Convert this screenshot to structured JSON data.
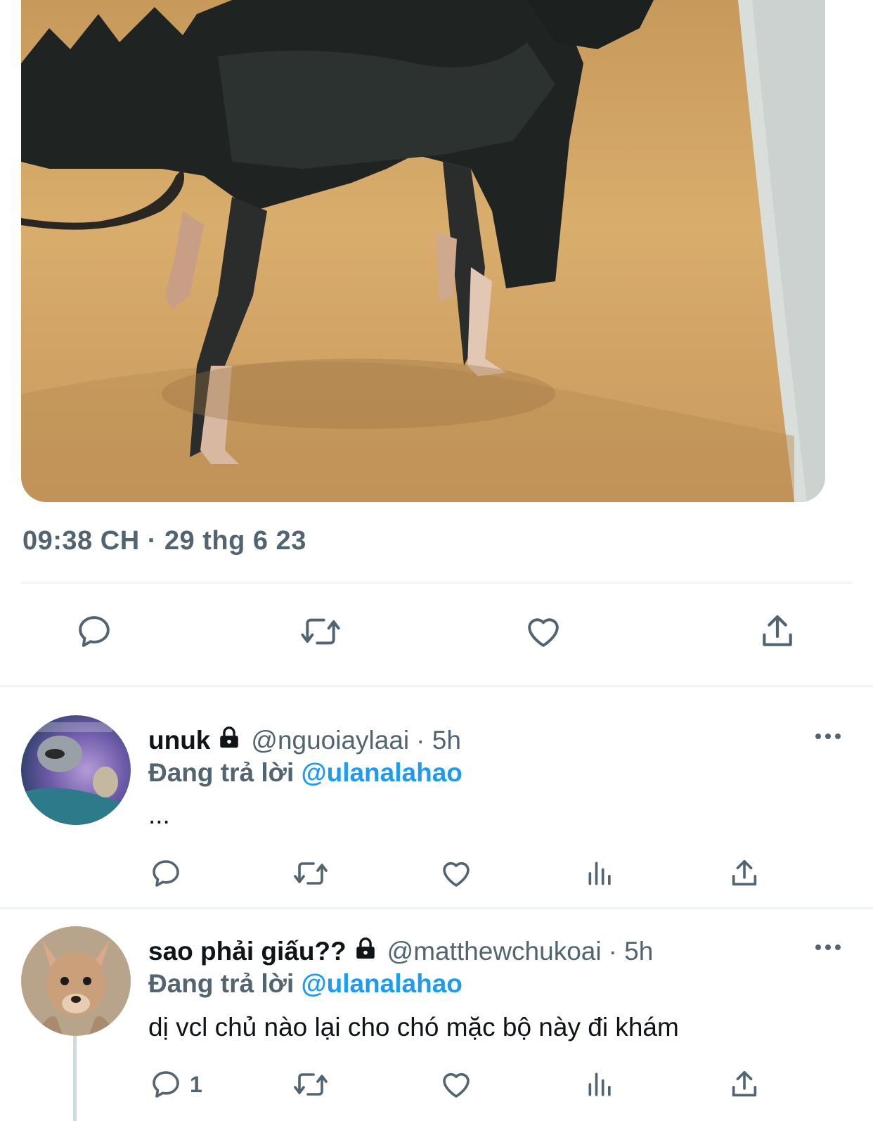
{
  "tweet": {
    "media_alt": "dog photo",
    "timestamp": "09:38 CH · 29 thg 6 23"
  },
  "tweet_actions": [
    "reply-icon",
    "retweet-icon",
    "like-icon",
    "share-icon"
  ],
  "replies": [
    {
      "display_name": "unuk",
      "handle": "@nguoiaylaai",
      "time": "· 5h",
      "replying_prefix": "Đang trả lời",
      "replying_to": "@ulanalahao",
      "text": "...",
      "reply_count": ""
    },
    {
      "display_name": "sao phải giấu??",
      "handle": "@matthewchukoai",
      "time": "· 5h",
      "replying_prefix": "Đang trả lời",
      "replying_to": "@ulanalahao",
      "text": "dị vcl chủ nào lại cho chó mặc bộ này đi khám",
      "reply_count": "1"
    }
  ],
  "colors": {
    "secondary_text": "#536471",
    "accent": "#1d9bf0",
    "divider": "#eff3f4"
  }
}
